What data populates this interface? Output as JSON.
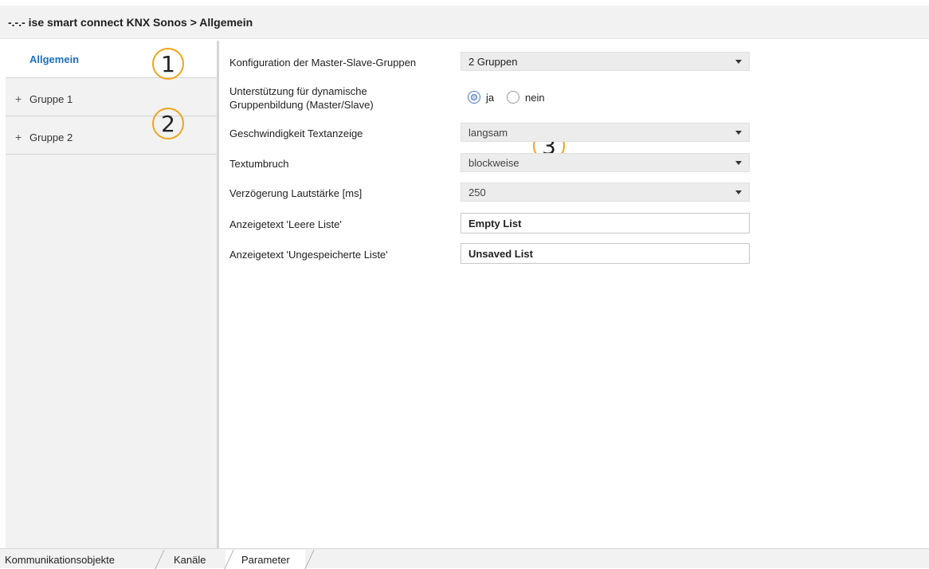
{
  "window": {
    "title": "-.-.- ise smart connect KNX Sonos > Allgemein"
  },
  "sidebar": {
    "items": [
      {
        "label": "Allgemein",
        "expander": ""
      },
      {
        "label": "Gruppe 1",
        "expander": "+"
      },
      {
        "label": "Gruppe 2",
        "expander": "+"
      }
    ]
  },
  "annotations": [
    "1",
    "2",
    "3"
  ],
  "form": {
    "master_slave": {
      "label": "Konfiguration der Master-Slave-Gruppen",
      "value": "2 Gruppen"
    },
    "dynamic_groups": {
      "label_line1": "Unterstützung für dynamische",
      "label_line2": "Gruppenbildung (Master/Slave)",
      "options": [
        "ja",
        "nein"
      ],
      "selected": "ja"
    },
    "text_speed": {
      "label": "Geschwindigkeit Textanzeige",
      "value": "langsam"
    },
    "text_wrap": {
      "label": "Textumbruch",
      "value": "blockweise"
    },
    "volume_delay": {
      "label": "Verzögerung Lautstärke [ms]",
      "value": "250"
    },
    "empty_list_text": {
      "label": "Anzeigetext 'Leere Liste'",
      "value": "Empty List"
    },
    "unsaved_list_text": {
      "label": "Anzeigetext 'Ungespeicherte Liste'",
      "value": "Unsaved List"
    }
  },
  "tabs": {
    "items": [
      "Kommunikationsobjekte",
      "Kanäle",
      "Parameter"
    ],
    "active": "Parameter"
  },
  "colors": {
    "accent": "#1a6fc0",
    "annotation": "#f0a41a"
  }
}
